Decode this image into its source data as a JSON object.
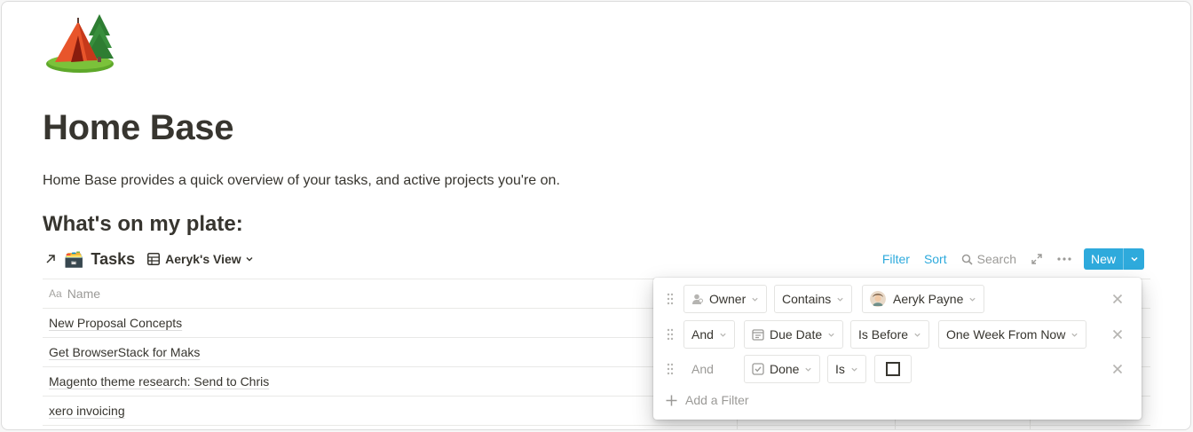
{
  "page": {
    "title": "Home Base",
    "description": "Home Base provides a quick overview of your tasks, and active projects you're on.",
    "section_heading": "What's on my plate:"
  },
  "database": {
    "emoji": "🗃️",
    "title": "Tasks",
    "view_name": "Aeryk's View",
    "actions": {
      "filter": "Filter",
      "sort": "Sort",
      "search": "Search",
      "new": "New"
    },
    "columns": [
      {
        "label": "Name",
        "type_icon": "Aa"
      }
    ],
    "rows": [
      {
        "name": "New Proposal Concepts"
      },
      {
        "name": "Get BrowserStack for Maks"
      },
      {
        "name": "Magento theme research: Send to Chris"
      },
      {
        "name": "xero invoicing"
      }
    ]
  },
  "filters": {
    "rows": [
      {
        "conjunction": "",
        "property": "Owner",
        "property_icon": "person-icon",
        "operator": "Contains",
        "value": "Aeryk Payne",
        "value_type": "person"
      },
      {
        "conjunction": "And",
        "property": "Due Date",
        "property_icon": "calendar-icon",
        "operator": "Is Before",
        "value": "One Week From Now",
        "value_type": "select"
      },
      {
        "conjunction": "And",
        "property": "Done",
        "property_icon": "checkbox-icon",
        "operator": "Is",
        "value": "unchecked",
        "value_type": "checkbox"
      }
    ],
    "add_label": "Add a Filter"
  },
  "colors": {
    "accent": "#2eaadc",
    "text": "#37352f",
    "muted": "#9b9a97",
    "border": "#e9e9e7"
  }
}
